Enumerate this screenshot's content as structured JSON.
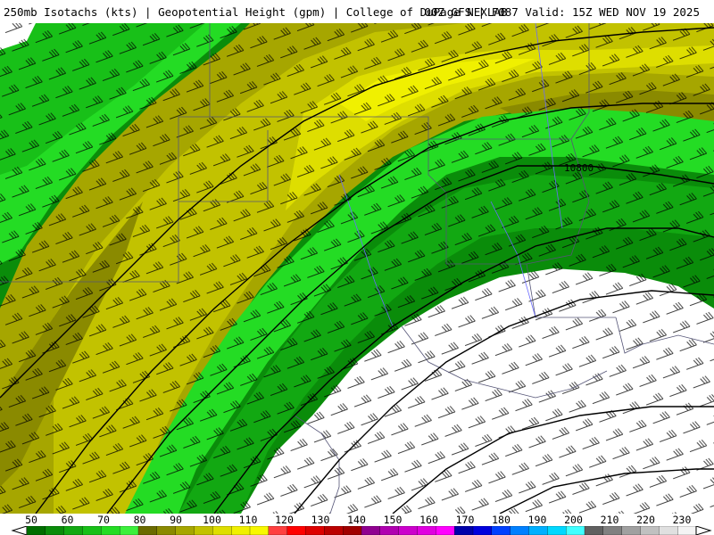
{
  "header": {
    "left": "250mb Isotachs (kts) | Geopotential Height (gpm) | College of DuPage NEXLAB",
    "right": "00Z GFS | F087 Valid: 15Z WED NOV 19 2025"
  },
  "map": {
    "height_contour_label": "10800"
  },
  "legend": {
    "ticks": [
      "50",
      "60",
      "70",
      "80",
      "90",
      "100",
      "110",
      "120",
      "130",
      "140",
      "150",
      "160",
      "170",
      "180",
      "190",
      "200",
      "210",
      "220",
      "230"
    ],
    "colors": [
      "#006e00",
      "#0a8c0a",
      "#12a812",
      "#18c018",
      "#24dc24",
      "#3cf03c",
      "#6b6b00",
      "#8a8a00",
      "#a6a600",
      "#c2c200",
      "#dede00",
      "#f0f000",
      "#f8f800",
      "#ff4040",
      "#ff0000",
      "#dd0000",
      "#bb0000",
      "#a00000",
      "#900090",
      "#b000b0",
      "#cc00cc",
      "#e000e0",
      "#ff00ff",
      "#0000aa",
      "#0000dd",
      "#0040ff",
      "#0080ff",
      "#00b0ff",
      "#00d8ff",
      "#40ffff",
      "#606060",
      "#808080",
      "#a0a0a0",
      "#c0c0c0",
      "#e0e0e0",
      "#f4f4f4"
    ]
  }
}
